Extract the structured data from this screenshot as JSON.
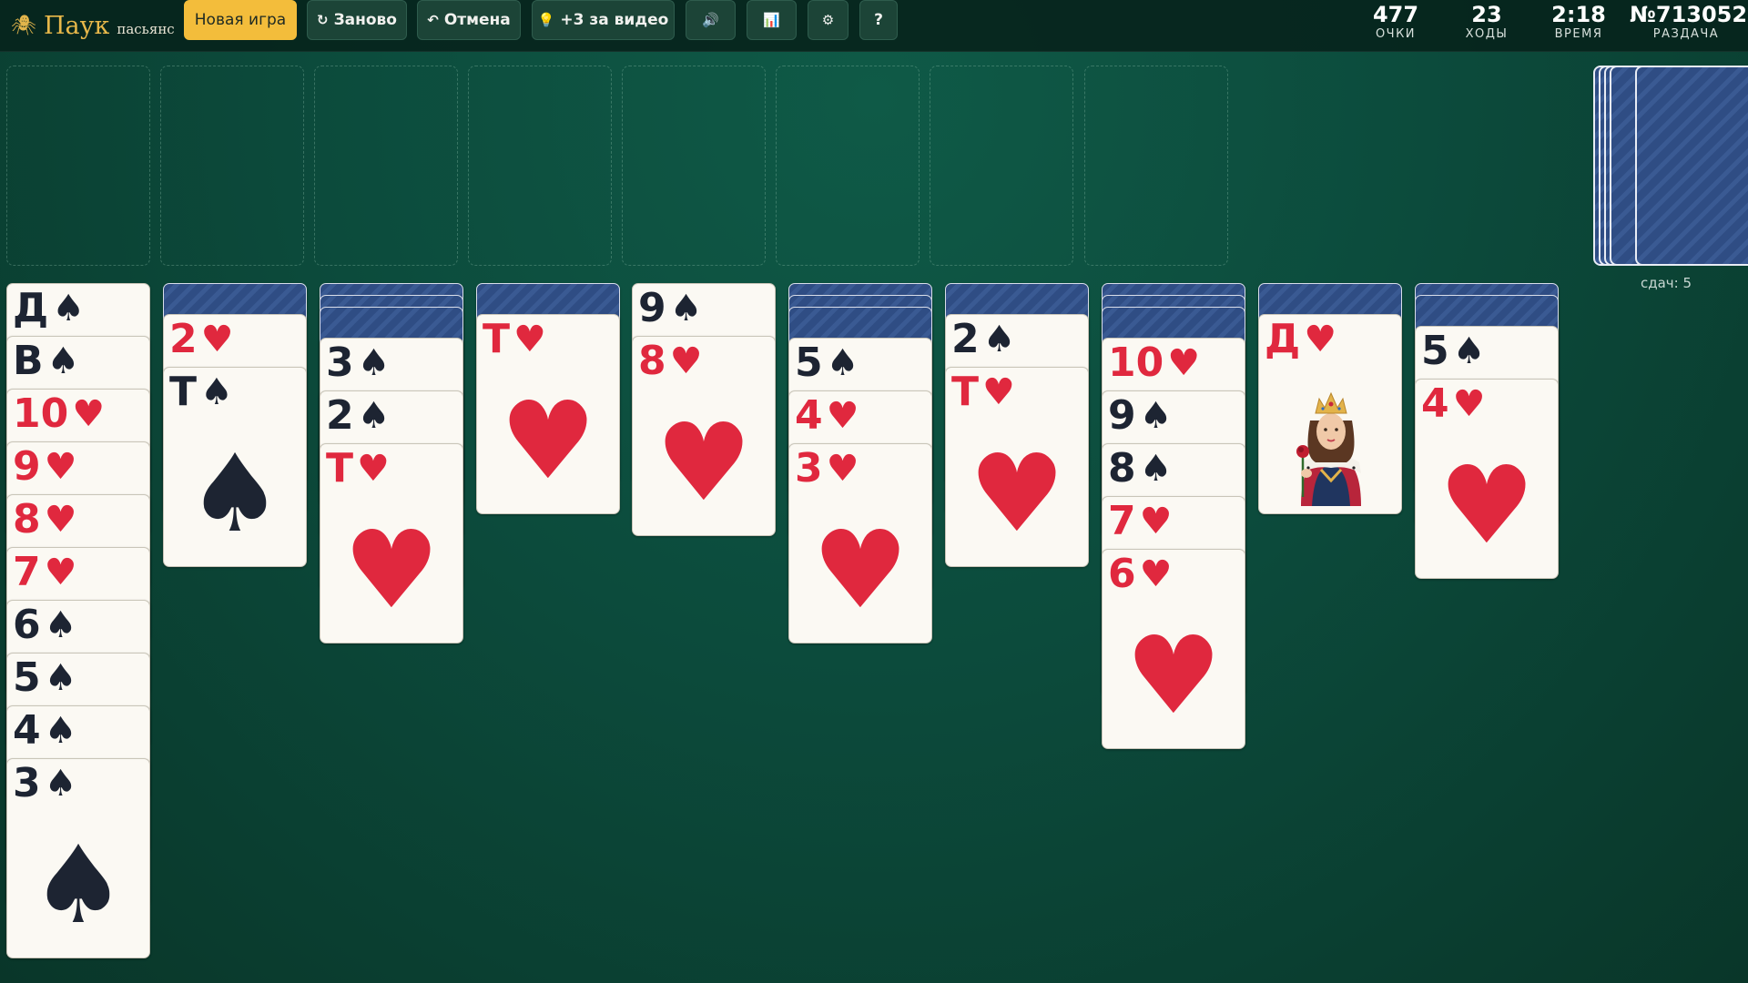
{
  "header": {
    "logo_title": "Паук",
    "logo_subtitle": "пасьянс",
    "buttons": {
      "new_game": "Новая игра",
      "restart": "Заново",
      "undo": "Отмена",
      "hint_video": "+3 за видео",
      "help": "?"
    },
    "icons": {
      "restart": "↻",
      "undo": "↶",
      "hint": "💡",
      "sound": "🔊",
      "stats": "📊",
      "settings": "⚙",
      "logo": "🕷"
    },
    "stats": [
      {
        "value": "477",
        "label": "ОЧКИ"
      },
      {
        "value": "23",
        "label": "ХОДЫ"
      },
      {
        "value": "2:18",
        "label": "ВРЕМЯ"
      },
      {
        "value": "№713052",
        "label": "РАЗДАЧА"
      }
    ]
  },
  "stock": {
    "label": "сдач: 5",
    "remaining_deals": 5
  },
  "foundations_filled": 0,
  "colors": {
    "accent": "#f3bd3b",
    "red_suit": "#e0283e",
    "black_suit": "#1d2432",
    "card_back": "#2f4d84",
    "felt": "#0c4b3c"
  },
  "tableau": [
    {
      "hidden": 0,
      "cards": [
        {
          "rank": "Д",
          "suit": "♠",
          "color": "black"
        },
        {
          "rank": "В",
          "suit": "♠",
          "color": "black"
        },
        {
          "rank": "10",
          "suit": "♥",
          "color": "red"
        },
        {
          "rank": "9",
          "suit": "♥",
          "color": "red"
        },
        {
          "rank": "8",
          "suit": "♥",
          "color": "red"
        },
        {
          "rank": "7",
          "suit": "♥",
          "color": "red"
        },
        {
          "rank": "6",
          "suit": "♠",
          "color": "black"
        },
        {
          "rank": "5",
          "suit": "♠",
          "color": "black"
        },
        {
          "rank": "4",
          "suit": "♠",
          "color": "black"
        },
        {
          "rank": "3",
          "suit": "♠",
          "color": "black"
        }
      ]
    },
    {
      "hidden": 1,
      "cards": [
        {
          "rank": "2",
          "suit": "♥",
          "color": "red"
        },
        {
          "rank": "Т",
          "suit": "♠",
          "color": "black"
        }
      ]
    },
    {
      "hidden": 3,
      "cards": [
        {
          "rank": "3",
          "suit": "♠",
          "color": "black"
        },
        {
          "rank": "2",
          "suit": "♠",
          "color": "black"
        },
        {
          "rank": "Т",
          "suit": "♥",
          "color": "red"
        }
      ]
    },
    {
      "hidden": 1,
      "cards": [
        {
          "rank": "Т",
          "suit": "♥",
          "color": "red"
        }
      ]
    },
    {
      "hidden": 0,
      "cards": [
        {
          "rank": "9",
          "suit": "♠",
          "color": "black"
        },
        {
          "rank": "8",
          "suit": "♥",
          "color": "red"
        }
      ]
    },
    {
      "hidden": 3,
      "cards": [
        {
          "rank": "5",
          "suit": "♠",
          "color": "black"
        },
        {
          "rank": "4",
          "suit": "♥",
          "color": "red"
        },
        {
          "rank": "3",
          "suit": "♥",
          "color": "red"
        }
      ]
    },
    {
      "hidden": 1,
      "cards": [
        {
          "rank": "2",
          "suit": "♠",
          "color": "black"
        },
        {
          "rank": "Т",
          "suit": "♥",
          "color": "red"
        }
      ]
    },
    {
      "hidden": 3,
      "cards": [
        {
          "rank": "10",
          "suit": "♥",
          "color": "red"
        },
        {
          "rank": "9",
          "suit": "♠",
          "color": "black"
        },
        {
          "rank": "8",
          "suit": "♠",
          "color": "black"
        },
        {
          "rank": "7",
          "suit": "♥",
          "color": "red"
        },
        {
          "rank": "6",
          "suit": "♥",
          "color": "red"
        }
      ]
    },
    {
      "hidden": 1,
      "cards": [
        {
          "rank": "Д",
          "suit": "♥",
          "color": "red",
          "face_art": "queen-portrait"
        }
      ]
    },
    {
      "hidden": 2,
      "cards": [
        {
          "rank": "5",
          "suit": "♠",
          "color": "black"
        },
        {
          "rank": "4",
          "suit": "♥",
          "color": "red"
        }
      ]
    }
  ]
}
